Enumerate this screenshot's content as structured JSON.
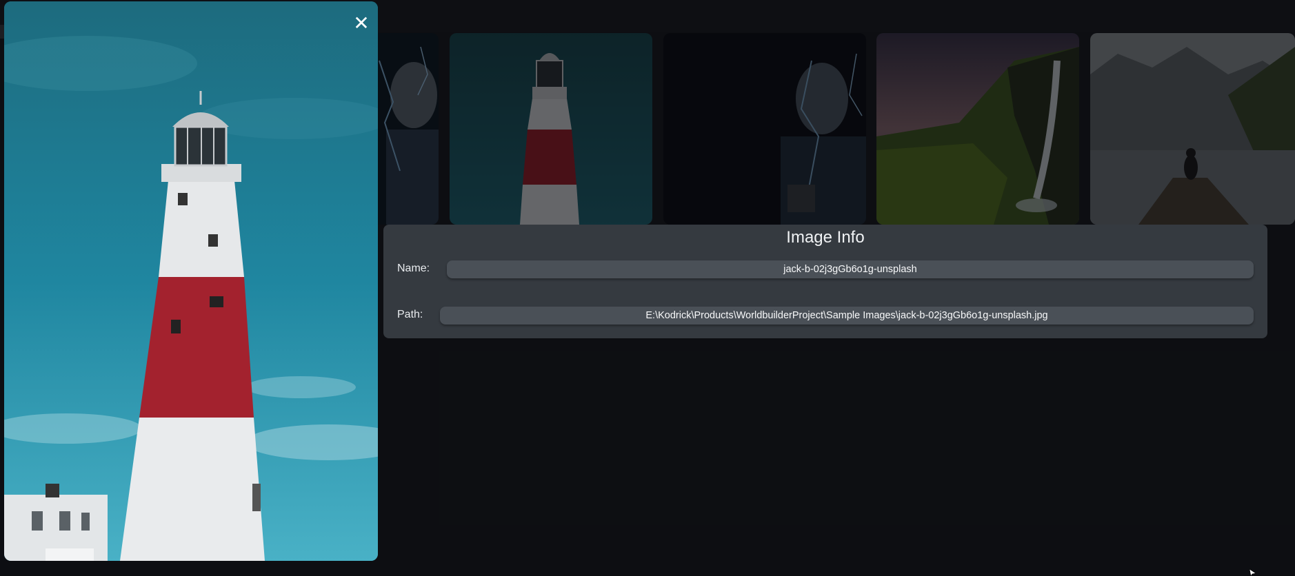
{
  "preview": {
    "close_glyph": "✕",
    "image_icon": "lighthouse-image"
  },
  "gallery": {
    "thumbnails": [
      {
        "icon": "man-lightning-image"
      },
      {
        "icon": "lighthouse-image"
      },
      {
        "icon": "man-lightning-dark-image"
      },
      {
        "icon": "waterfall-image"
      },
      {
        "icon": "lake-dock-image"
      }
    ]
  },
  "info": {
    "title": "Image Info",
    "name_label": "Name:",
    "name_value": "jack-b-02j3gGb6o1g-unsplash",
    "path_label": "Path:",
    "path_value": "E:\\Kodrick\\Products\\WorldbuilderProject\\Sample Images\\jack-b-02j3gGb6o1g-unsplash.jpg"
  },
  "colors": {
    "panel": "#353a40",
    "field": "#4a5057",
    "lighthouse_red": "#a3222e",
    "sky": "#1e7f92"
  }
}
